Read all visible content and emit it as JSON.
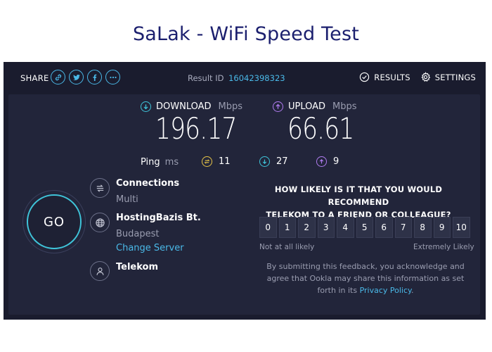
{
  "page_title": "SaLak - WiFi Speed Test",
  "topbar": {
    "share_label": "SHARE",
    "share_icons": [
      "link-icon",
      "twitter-icon",
      "facebook-icon",
      "more-icon"
    ],
    "result_id_label": "Result ID",
    "result_id": "16042398323",
    "results_label": "RESULTS",
    "settings_label": "SETTINGS"
  },
  "download": {
    "label": "DOWNLOAD",
    "unit": "Mbps",
    "value": "196.17",
    "color": "#3fc4d9"
  },
  "upload": {
    "label": "UPLOAD",
    "unit": "Mbps",
    "value": "66.61",
    "color": "#b07cf0"
  },
  "ping": {
    "label": "Ping",
    "unit": "ms",
    "idle": {
      "value": "11",
      "color": "#e8c447"
    },
    "download": {
      "value": "27",
      "color": "#3fc4d9"
    },
    "upload": {
      "value": "9",
      "color": "#b07cf0"
    }
  },
  "go_label": "GO",
  "server": {
    "connections_title": "Connections",
    "connections_value": "Multi",
    "host_title": "HostingBazis Bt.",
    "host_location": "Budapest",
    "change_server": "Change Server",
    "isp": "Telekom"
  },
  "survey": {
    "question_line1": "HOW LIKELY IS IT THAT YOU WOULD RECOMMEND",
    "question_line2": "TELEKOM TO A FRIEND OR COLLEAGUE?",
    "scale": [
      "0",
      "1",
      "2",
      "3",
      "4",
      "5",
      "6",
      "7",
      "8",
      "9",
      "10"
    ],
    "low_label": "Not at all likely",
    "high_label": "Extremely Likely",
    "note_line1": "By submitting this feedback, you acknowledge and",
    "note_line2": "agree that Ookla may share this information as set",
    "note_line3_prefix": "forth in its ",
    "privacy_link": "Privacy Policy",
    "note_line3_suffix": "."
  },
  "colors": {
    "background": "#1a1c2e",
    "card": "#22253a",
    "accent": "#4ab9e8",
    "title": "#1b1f6e"
  }
}
